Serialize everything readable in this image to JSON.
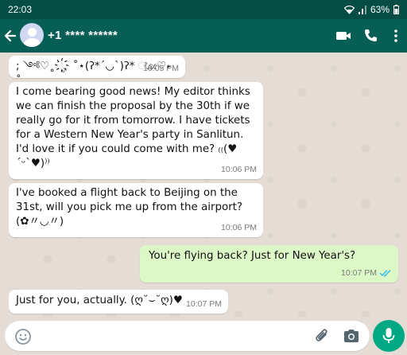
{
  "status_bar": {
    "time": "22:03",
    "battery": "63%"
  },
  "header": {
    "contact_name": "+1 **** ******"
  },
  "messages": [
    {
      "direction": "in",
      "text": "; ༺♡˳ೃ҉ ˚⋆(ʔ*´◡`)ʔ* ೋ♡˖ ˚",
      "time": "10:05 PM"
    },
    {
      "direction": "in",
      "text": "I come bearing good news! My editor thinks we can finish the proposal by the 30th if we really go for it from tomorrow. I have tickets for a Western New Year's party in Sanlitun. I'd love it if you could come with me? ₍₍(♥´ᵕ`♥)⁾⁾",
      "time": "10:06 PM"
    },
    {
      "direction": "in",
      "text": "I've booked a flight back to Beijing on the 31st, will you pick me up from the airport? (✿〃◡〃)",
      "time": "10:06 PM"
    },
    {
      "direction": "out",
      "text": "You're flying back? Just for New Year's?",
      "time": "10:07 PM",
      "status": "read"
    },
    {
      "direction": "in",
      "text": "Just for you, actually. (ღ˘⌣˘ღ)♥",
      "time": "10:07 PM"
    }
  ],
  "input": {
    "value": "",
    "placeholder": ""
  },
  "colors": {
    "header": "#075e54",
    "incoming_bubble": "#ffffff",
    "outgoing_bubble": "#dcf8c6",
    "read_ticks": "#34b7f1",
    "mic_button": "#00a884"
  },
  "icons": [
    "back-arrow-icon",
    "avatar-icon",
    "video-call-icon",
    "phone-icon",
    "more-vert-icon",
    "emoji-icon",
    "attach-icon",
    "camera-icon",
    "mic-icon",
    "read-ticks-icon",
    "wifi-icon",
    "signal-icon",
    "battery-icon"
  ]
}
